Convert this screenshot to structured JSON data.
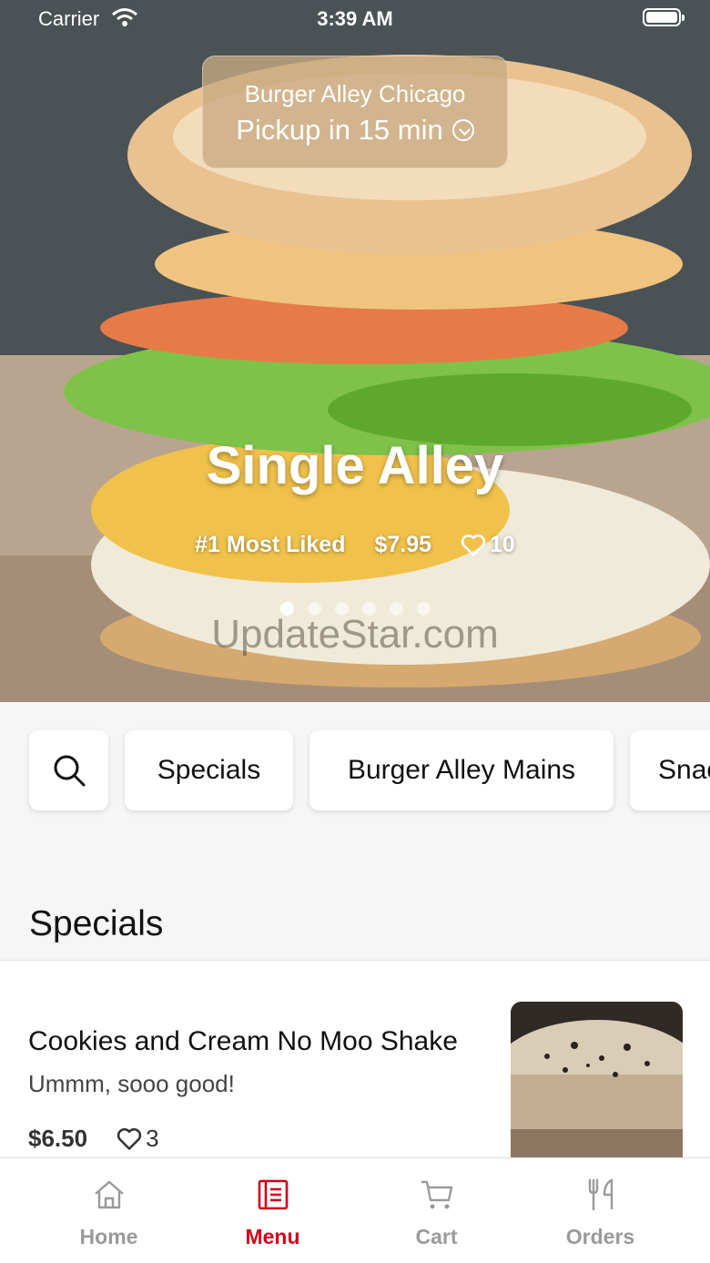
{
  "status_bar": {
    "carrier": "Carrier",
    "time": "3:39 AM"
  },
  "pickup": {
    "location": "Burger Alley Chicago",
    "time": "Pickup in 15 min"
  },
  "hero": {
    "title": "Single Alley",
    "rank": "#1 Most Liked",
    "price": "$7.95",
    "likes": "10",
    "dots_count": 6,
    "active_dot": 0,
    "watermark": "UpdateStar.com"
  },
  "categories": [
    "Specials",
    "Burger Alley Mains",
    "Snacks"
  ],
  "section": {
    "title": "Specials"
  },
  "items": [
    {
      "name": "Cookies and Cream No Moo Shake",
      "description": "Ummm, sooo good!",
      "price": "$6.50",
      "likes": "3"
    }
  ],
  "tabs": [
    {
      "label": "Home",
      "active": false
    },
    {
      "label": "Menu",
      "active": true
    },
    {
      "label": "Cart",
      "active": false
    },
    {
      "label": "Orders",
      "active": false
    }
  ],
  "colors": {
    "accent": "#d0021b",
    "inactive": "#9a9a9a"
  }
}
